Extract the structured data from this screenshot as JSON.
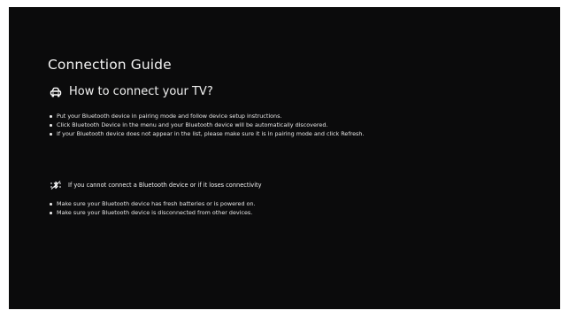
{
  "page": {
    "title": "Connection Guide"
  },
  "how_to": {
    "icon": "car-icon",
    "heading": "How to connect your TV?",
    "items": [
      "Put your Bluetooth device in pairing mode and follow device setup instructions.",
      "Click Bluetooth Device in the menu and your Bluetooth device will be automatically discovered.",
      "If your Bluetooth device does not appear in the list, please make sure it is in pairing mode and click Refresh."
    ]
  },
  "troubleshoot": {
    "icon": "bluetooth-off-icon",
    "heading": "If you cannot connect a Bluetooth device or if it loses connectivity",
    "items": [
      "Make sure your Bluetooth device has fresh batteries or is powered on.",
      "Make sure your Bluetooth device is disconnected from other devices."
    ]
  },
  "colors": {
    "background": "#0b0b0c",
    "text": "#ffffff"
  }
}
